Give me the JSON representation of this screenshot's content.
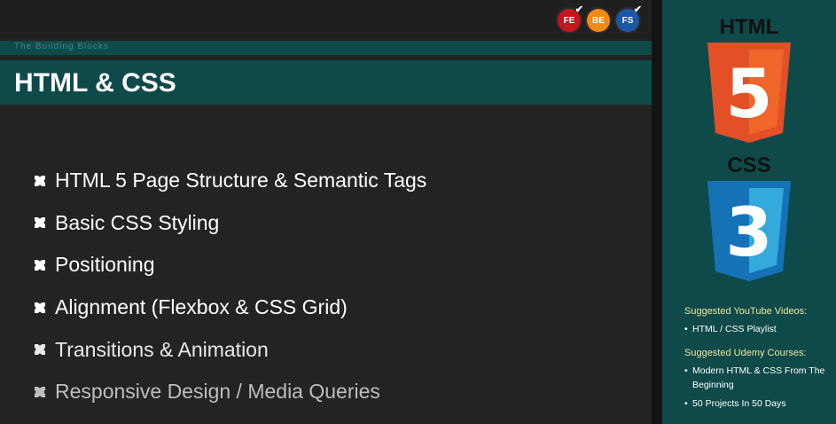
{
  "header": {
    "badges": [
      {
        "label": "FE",
        "color": "#c0181c"
      },
      {
        "label": "BE",
        "color": "#f08a10"
      },
      {
        "label": "FS",
        "color": "#1d57a8"
      }
    ],
    "checkmark": "✔"
  },
  "section": {
    "subtitle": "The Building Blocks",
    "title": "HTML & CSS"
  },
  "topics": [
    {
      "label": "HTML 5 Page Structure & Semantic Tags",
      "color": "#ffffff"
    },
    {
      "label": "Basic CSS Styling",
      "color": "#ffffff"
    },
    {
      "label": "Positioning",
      "color": "#ffffff"
    },
    {
      "label": "Alignment (Flexbox & CSS Grid)",
      "color": "#ffffff"
    },
    {
      "label": "Transitions & Animation",
      "color": "#e8e8e8"
    },
    {
      "label": "Responsive Design / Media Queries",
      "color": "#bdbdbd"
    }
  ],
  "sidebar": {
    "html_logo": {
      "text": "HTML",
      "number": "5",
      "color": "#e34f26"
    },
    "css_logo": {
      "text": "CSS",
      "number": "3",
      "color": "#1572b6"
    },
    "youtube_heading": "Suggested YouTube Videos:",
    "youtube_items": [
      "HTML / CSS Playlist"
    ],
    "udemy_heading": "Suggested Udemy Courses:",
    "udemy_items": [
      "Modern HTML & CSS From The Beginning",
      "50 Projects In 50 Days"
    ],
    "bullet": "•"
  }
}
